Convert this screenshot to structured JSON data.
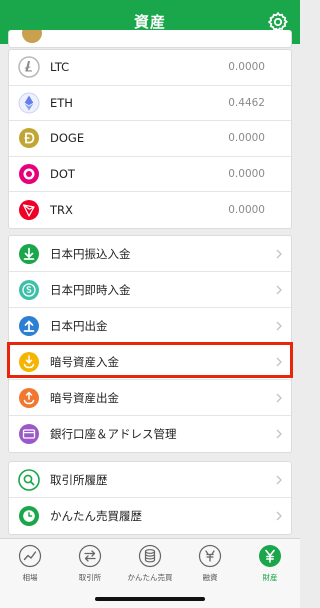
{
  "header": {
    "title": "資産"
  },
  "coins": [
    {
      "symbol": "LTC",
      "amount": "0.0000",
      "icon": "litecoin-icon",
      "color": "#b8b8b8"
    },
    {
      "symbol": "ETH",
      "amount": "0.4462",
      "icon": "ethereum-icon",
      "color": "#627eea"
    },
    {
      "symbol": "DOGE",
      "amount": "0.0000",
      "icon": "dogecoin-icon",
      "color": "#c2a633"
    },
    {
      "symbol": "DOT",
      "amount": "0.0000",
      "icon": "polkadot-icon",
      "color": "#e6007a"
    },
    {
      "symbol": "TRX",
      "amount": "0.0000",
      "icon": "tron-icon",
      "color": "#ef0027"
    }
  ],
  "menu": [
    {
      "label": "日本円振込入金",
      "icon": "download-icon",
      "color": "#1aa64a"
    },
    {
      "label": "日本円即時入金",
      "icon": "yen-coin-icon",
      "color": "#3cc0a8"
    },
    {
      "label": "日本円出金",
      "icon": "upload-icon",
      "color": "#2d7fd4"
    },
    {
      "label": "暗号資産入金",
      "icon": "crypto-deposit-icon",
      "color": "#f5b400"
    },
    {
      "label": "暗号資産出金",
      "icon": "crypto-withdraw-icon",
      "color": "#f07830"
    },
    {
      "label": "銀行口座＆アドレス管理",
      "icon": "card-icon",
      "color": "#9b59c8"
    }
  ],
  "history": [
    {
      "label": "取引所履歴",
      "icon": "search-history-icon",
      "color": "#1aa64a"
    },
    {
      "label": "かんたん売買履歴",
      "icon": "clock-history-icon",
      "color": "#1aa64a"
    }
  ],
  "tabs": [
    {
      "label": "相場",
      "icon": "chart-icon",
      "active": false
    },
    {
      "label": "取引所",
      "icon": "exchange-icon",
      "active": false
    },
    {
      "label": "かんたん売買",
      "icon": "coins-icon",
      "active": false
    },
    {
      "label": "融資",
      "icon": "loan-icon",
      "active": false
    },
    {
      "label": "財産",
      "icon": "yen-icon",
      "active": true
    }
  ],
  "colors": {
    "brand": "#1aa64a",
    "highlight": "#e8260c"
  }
}
